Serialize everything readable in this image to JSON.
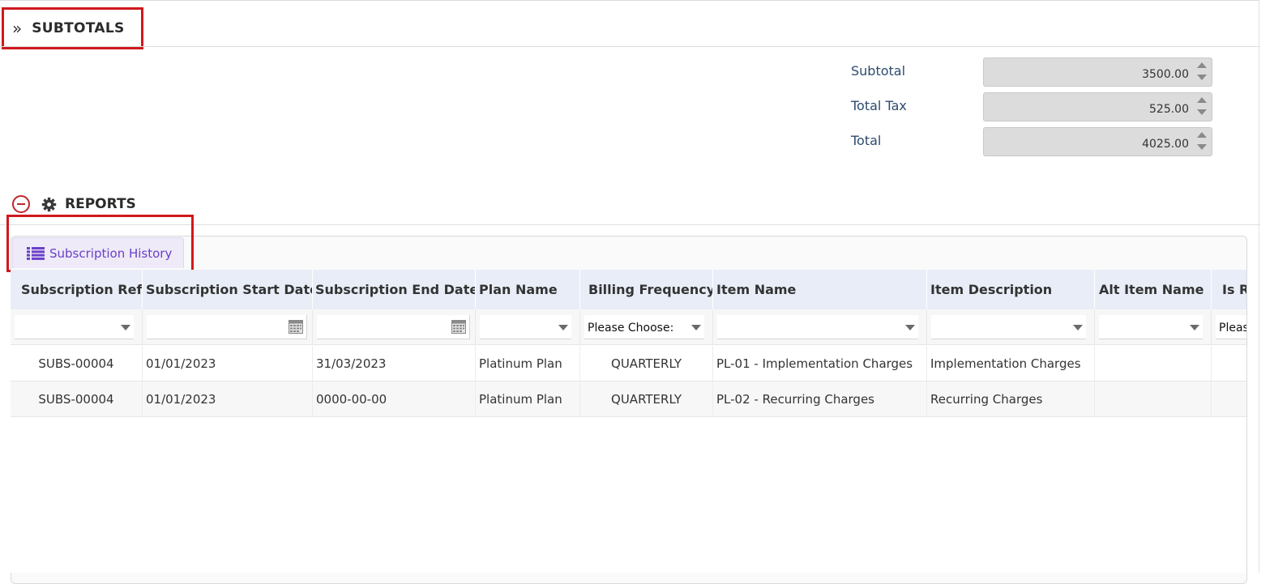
{
  "subtotals": {
    "title": "SUBTOTALS",
    "rows": [
      {
        "label": "Subtotal",
        "value": "3500.00"
      },
      {
        "label": "Total Tax",
        "value": "525.00"
      },
      {
        "label": "Total",
        "value": "4025.00"
      }
    ]
  },
  "reports": {
    "title": "REPORTS",
    "tab_label": "Subscription History"
  },
  "grid": {
    "columns": [
      "Subscription Ref.",
      "Subscription Start Date",
      "Subscription End Date",
      "Plan Name",
      "Billing Frequency",
      "Item Name",
      "Item Description",
      "Alt Item Name",
      "Is Re"
    ],
    "filters": {
      "billing_frequency": "Please Choose:",
      "last": "Pleas"
    },
    "rows": [
      [
        "SUBS-00004",
        "01/01/2023",
        "31/03/2023",
        "Platinum Plan",
        "QUARTERLY",
        "PL-01 - Implementation Charges",
        "Implementation Charges",
        "",
        ""
      ],
      [
        "SUBS-00004",
        "01/01/2023",
        "0000-00-00",
        "Platinum Plan",
        "QUARTERLY",
        "PL-02 - Recurring Charges",
        "Recurring Charges",
        "",
        ""
      ]
    ]
  },
  "colors": {
    "highlight_border": "#d0191d",
    "header_bg": "#e8edf7",
    "tab_text": "#6a3fc9",
    "label_text": "#2d4b6e"
  },
  "icons": [
    "chevron-double-right-icon",
    "collapse-minus-icon",
    "gear-icon",
    "list-icon",
    "calendar-icon",
    "caret-down-icon",
    "spinner-up-icon",
    "spinner-down-icon"
  ]
}
